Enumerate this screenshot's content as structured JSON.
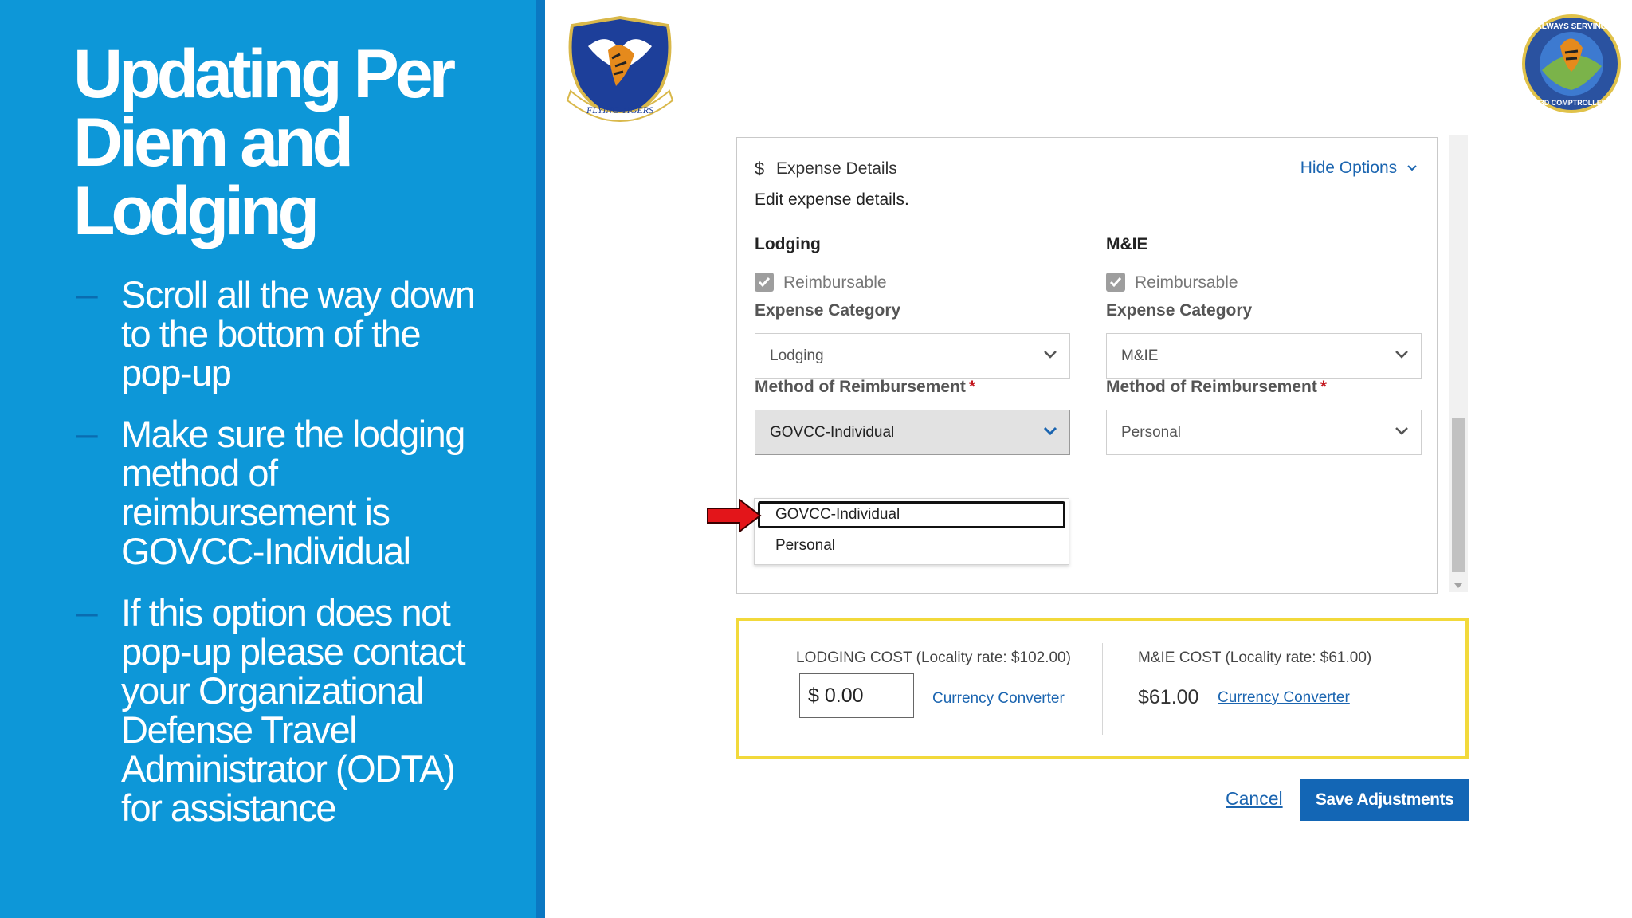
{
  "slide": {
    "title": "Updating Per Diem and Lodging",
    "bullets": [
      "Scroll all the way down to the bottom of the pop-up",
      "Make sure the lodging method of reimbursement is GOVCC-Individual",
      "If this option does not pop-up please contact your Organizational Defense Travel Administrator (ODTA) for assistance"
    ],
    "bullet_marker": "–"
  },
  "logos": {
    "left_text": "FLYING TIGERS",
    "right_text_top": "ALWAYS SERVING",
    "right_text_bottom": "23D COMPTROLLER"
  },
  "expense_details": {
    "icon_glyph": "$",
    "title": "Expense Details",
    "subtitle": "Edit expense details.",
    "hide_options": "Hide Options",
    "lodging": {
      "title": "Lodging",
      "reimbursable_label": "Reimbursable",
      "reimbursable_checked": true,
      "category_label": "Expense Category",
      "category_value": "Lodging",
      "method_label": "Method of Reimbursement",
      "required_mark": "*",
      "method_value": "GOVCC-Individual"
    },
    "mie": {
      "title": "M&IE",
      "reimbursable_label": "Reimbursable",
      "reimbursable_checked": true,
      "category_label": "Expense Category",
      "category_value": "M&IE",
      "method_label": "Method of Reimbursement",
      "required_mark": "*",
      "method_value": "Personal"
    },
    "dropdown_options": [
      "GOVCC-Individual",
      "Personal"
    ],
    "highlighted_option": "GOVCC-Individual"
  },
  "costs": {
    "lodging_label": "LODGING COST (Locality rate: $102.00)",
    "lodging_value": "$ 0.00",
    "lodging_link": "Currency Converter",
    "mie_label": "M&IE COST (Locality rate: $61.00)",
    "mie_value": "$61.00",
    "mie_link": "Currency Converter"
  },
  "actions": {
    "cancel": "Cancel",
    "save": "Save Adjustments"
  },
  "colors": {
    "left_panel_bg": "#0d97d8",
    "accent_blue": "#1366b5",
    "highlight_yellow": "#f2d93b",
    "arrow_red": "#e3151a"
  }
}
